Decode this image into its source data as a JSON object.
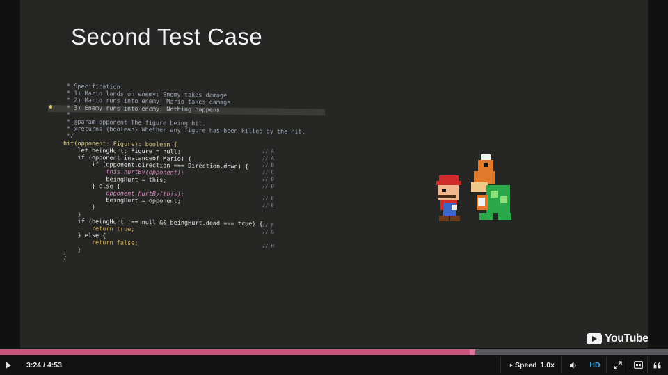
{
  "slide": {
    "title": "Second Test Case"
  },
  "code": {
    "lines": [
      "* Specification:",
      "* 1) Mario lands on enemy: Enemy takes damage",
      "* 2) Mario runs into enemy: Mario takes damage",
      "* 3) Enemy runs into enemy: Nothing happens",
      "*",
      "* @param opponent The figure being hit.",
      "* @returns {boolean} Whether any figure has been killed by the hit.",
      "*/",
      "hit(opponent: Figure): boolean {",
      "    let beingHurt: Figure = null;",
      "    if (opponent instanceof Mario) {",
      "        if (opponent.direction === Direction.down) {",
      "            this.hurtBy(opponent);",
      "            beingHurt = this;",
      "        } else {",
      "            opponent.hurtBy(this);",
      "            beingHurt = opponent;",
      "        }",
      "    }",
      "    if (beingHurt !== null && beingHurt.dead === true) {",
      "        return true;",
      "    } else {",
      "        return false;",
      "    }",
      "}"
    ],
    "annotations": [
      "// A",
      "// A",
      "// B",
      "// C",
      "// D",
      "// D",
      "// E",
      "// E",
      "// F",
      "// G",
      "// H"
    ]
  },
  "sprite": {
    "icon": "mario-and-koopa-sprite"
  },
  "branding": {
    "logo_text": "YouTube"
  },
  "player": {
    "progress_fraction": 0.707,
    "time_current": "3:24",
    "time_separator": "/",
    "time_total": "4:53",
    "speed_label": "Speed",
    "speed_value": "1.0x",
    "quality_label": "HD",
    "colors": {
      "progress_fill": "#c8557e",
      "progress_track": "#585a5f",
      "hd_accent": "#4aa8e0"
    }
  }
}
